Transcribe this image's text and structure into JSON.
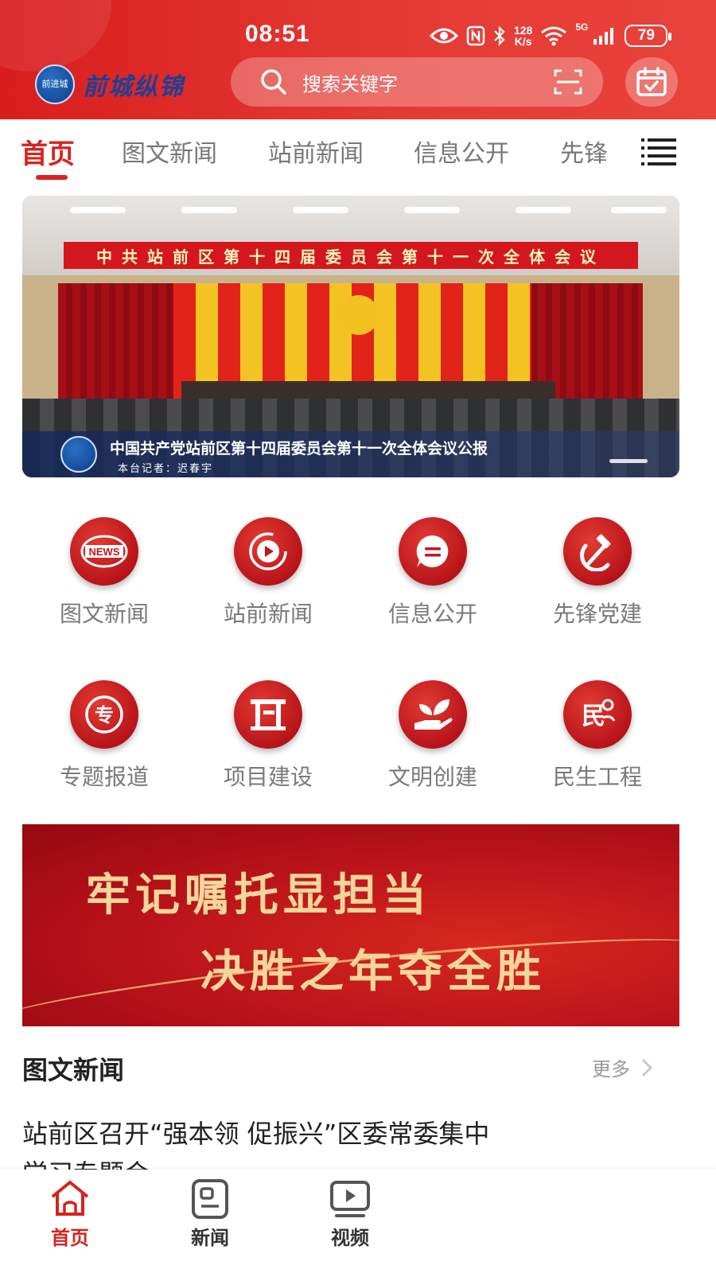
{
  "status_bar": {
    "time": "08:51",
    "net_speed_value": "128",
    "net_speed_unit": "K/s",
    "network": "5G",
    "battery": "79"
  },
  "header": {
    "logo_badge_text": "前进城",
    "logo_text": "前城纵锦",
    "search_placeholder": "搜索关键字"
  },
  "tabs": [
    {
      "label": "首页",
      "active": true
    },
    {
      "label": "图文新闻",
      "active": false
    },
    {
      "label": "站前新闻",
      "active": false
    },
    {
      "label": "信息公开",
      "active": false
    },
    {
      "label": "先锋",
      "active": false
    }
  ],
  "banner": {
    "stage_text": "中共站前区第十四届委员会第十一次全体会议",
    "caption": "中国共产党站前区第十四届委员会第十一次全体会议公报",
    "reporter": "本台记者：迟春宇"
  },
  "grid": [
    {
      "label": "图文新闻",
      "icon": "news-icon"
    },
    {
      "label": "站前新闻",
      "icon": "video-play-icon"
    },
    {
      "label": "信息公开",
      "icon": "message-icon"
    },
    {
      "label": "先锋党建",
      "icon": "hammer-sickle-icon"
    },
    {
      "label": "专题报道",
      "icon": "special-topic-icon"
    },
    {
      "label": "项目建设",
      "icon": "construction-icon"
    },
    {
      "label": "文明创建",
      "icon": "plant-hand-icon"
    },
    {
      "label": "民生工程",
      "icon": "livelihood-icon"
    }
  ],
  "promo": {
    "line1": "牢记嘱托显担当",
    "line2": "决胜之年夺全胜"
  },
  "news_section": {
    "title": "图文新闻",
    "more": "更多",
    "first_item": "站前区召开“强本领 促振兴”区委常委集中学习专题会"
  },
  "bottom_nav": [
    {
      "label": "首页",
      "icon": "home-icon",
      "active": true
    },
    {
      "label": "新闻",
      "icon": "news-doc-icon",
      "active": false
    },
    {
      "label": "视频",
      "icon": "video-icon",
      "active": false
    }
  ],
  "colors": {
    "brand_red": "#d8231d",
    "header_red": "#e53a34",
    "promo_gold": "#f3d79a"
  }
}
